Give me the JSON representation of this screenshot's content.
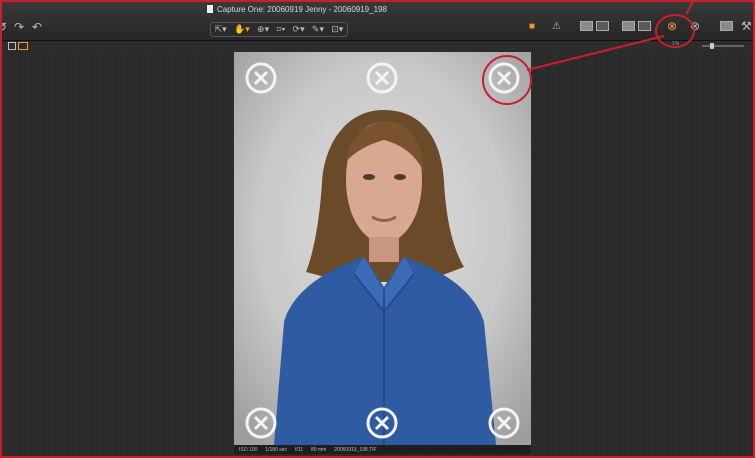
{
  "window": {
    "title": "Capture One: 20060919 Jenny - 20060919_198"
  },
  "toolbar": {
    "zoom_value": "1%",
    "icons": [
      "undo-icon",
      "redo-icon",
      "select-tool-icon",
      "hand-tool-icon",
      "zoom-tool-icon",
      "crop-tool-icon",
      "rotate-tool-icon",
      "color-picker-icon",
      "straighten-tool-icon",
      "folder-icon",
      "exposure-warning-icon",
      "grid-overlay-icon",
      "focus-mask-icon",
      "proof-icon",
      "print-icon",
      "sharpness-icon"
    ],
    "accent_color": "#f0a030"
  },
  "callout_color": "#c8202a",
  "photo_info": {
    "iso": "ISO 100",
    "shutter": "1/180 sec",
    "aperture": "f/11",
    "focal": "80 mm",
    "filename": "20060919_198.TIF"
  }
}
